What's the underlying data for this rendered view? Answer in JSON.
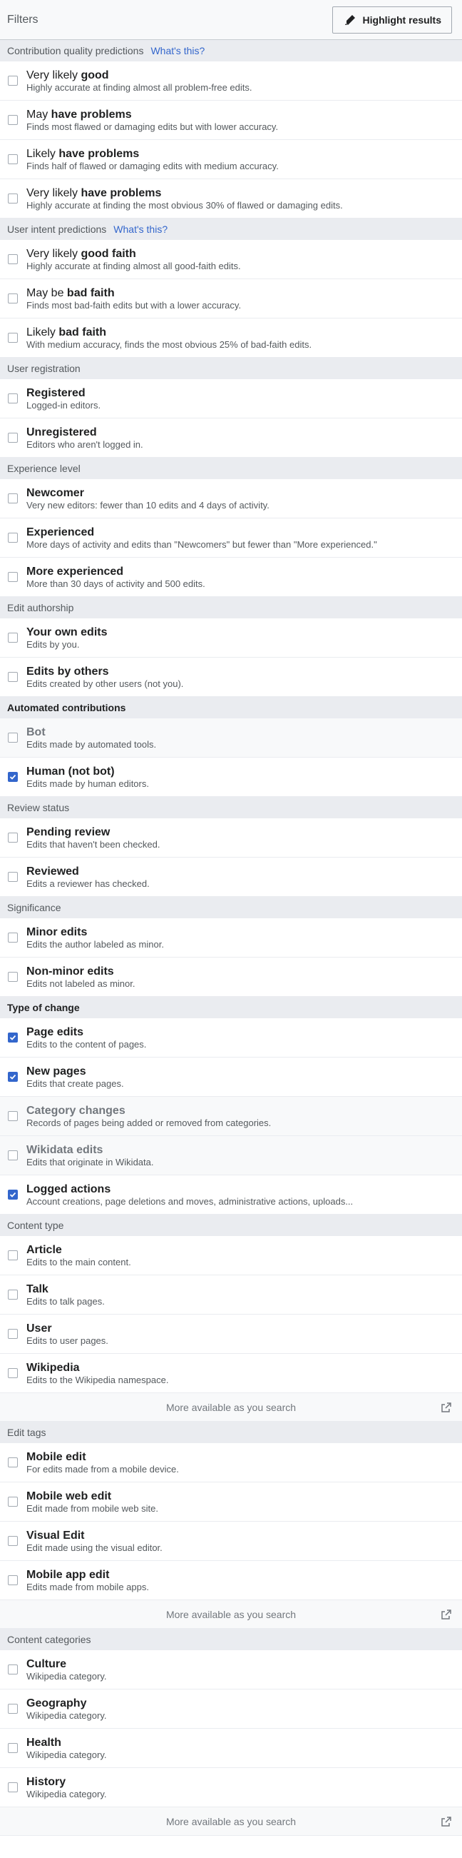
{
  "header": {
    "title": "Filters",
    "highlight_label": "Highlight results"
  },
  "sections": [
    {
      "title": "Contribution quality predictions",
      "link": "What's this?",
      "items": [
        {
          "pre": "Very likely ",
          "strong": "good",
          "post": "",
          "desc": "Highly accurate at finding almost all problem-free edits.",
          "checked": false,
          "muted": false
        },
        {
          "pre": "May ",
          "strong": "have problems",
          "post": "",
          "desc": "Finds most flawed or damaging edits but with lower accuracy.",
          "checked": false,
          "muted": false
        },
        {
          "pre": "Likely ",
          "strong": "have problems",
          "post": "",
          "desc": "Finds half of flawed or damaging edits with medium accuracy.",
          "checked": false,
          "muted": false
        },
        {
          "pre": "Very likely ",
          "strong": "have problems",
          "post": "",
          "desc": "Highly accurate at finding the most obvious 30% of flawed or damaging edits.",
          "checked": false,
          "muted": false
        }
      ]
    },
    {
      "title": "User intent predictions",
      "link": "What's this?",
      "items": [
        {
          "pre": "Very likely ",
          "strong": "good faith",
          "post": "",
          "desc": "Highly accurate at finding almost all good-faith edits.",
          "checked": false,
          "muted": false
        },
        {
          "pre": "May be ",
          "strong": "bad faith",
          "post": "",
          "desc": "Finds most bad-faith edits but with a lower accuracy.",
          "checked": false,
          "muted": false
        },
        {
          "pre": "Likely ",
          "strong": "bad faith",
          "post": "",
          "desc": "With medium accuracy, finds the most obvious 25% of bad-faith edits.",
          "checked": false,
          "muted": false
        }
      ]
    },
    {
      "title": "User registration",
      "items": [
        {
          "pre": "",
          "strong": "Registered",
          "post": "",
          "desc": "Logged-in editors.",
          "checked": false,
          "muted": false
        },
        {
          "pre": "",
          "strong": "Unregistered",
          "post": "",
          "desc": "Editors who aren't logged in.",
          "checked": false,
          "muted": false
        }
      ]
    },
    {
      "title": "Experience level",
      "items": [
        {
          "pre": "",
          "strong": "Newcomer",
          "post": "",
          "desc": "Very new editors: fewer than 10 edits and 4 days of activity.",
          "checked": false,
          "muted": false
        },
        {
          "pre": "",
          "strong": "Experienced",
          "post": "",
          "desc": "More days of activity and edits than \"Newcomers\" but fewer than \"More experienced.\"",
          "checked": false,
          "muted": false
        },
        {
          "pre": "",
          "strong": "More experienced",
          "post": "",
          "desc": "More than 30 days of activity and 500 edits.",
          "checked": false,
          "muted": false
        }
      ]
    },
    {
      "title": "Edit authorship",
      "items": [
        {
          "pre": "",
          "strong": "Your own edits",
          "post": "",
          "desc": "Edits by you.",
          "checked": false,
          "muted": false
        },
        {
          "pre": "",
          "strong": "Edits by others",
          "post": "",
          "desc": "Edits created by other users (not you).",
          "checked": false,
          "muted": false
        }
      ]
    },
    {
      "title": "Automated contributions",
      "bold": true,
      "items": [
        {
          "pre": "",
          "strong": "Bot",
          "post": "",
          "desc": "Edits made by automated tools.",
          "checked": false,
          "muted": true
        },
        {
          "pre": "",
          "strong": "Human (not bot)",
          "post": "",
          "desc": "Edits made by human editors.",
          "checked": true,
          "muted": false
        }
      ]
    },
    {
      "title": "Review status",
      "items": [
        {
          "pre": "",
          "strong": "Pending review",
          "post": "",
          "desc": "Edits that haven't been checked.",
          "checked": false,
          "muted": false
        },
        {
          "pre": "",
          "strong": "Reviewed",
          "post": "",
          "desc": "Edits a reviewer has checked.",
          "checked": false,
          "muted": false
        }
      ]
    },
    {
      "title": "Significance",
      "items": [
        {
          "pre": "",
          "strong": "Minor edits",
          "post": "",
          "desc": "Edits the author labeled as minor.",
          "checked": false,
          "muted": false
        },
        {
          "pre": "",
          "strong": "Non-minor edits",
          "post": "",
          "desc": "Edits not labeled as minor.",
          "checked": false,
          "muted": false
        }
      ]
    },
    {
      "title": "Type of change",
      "bold": true,
      "items": [
        {
          "pre": "",
          "strong": "Page edits",
          "post": "",
          "desc": "Edits to the content of pages.",
          "checked": true,
          "muted": false
        },
        {
          "pre": "",
          "strong": "New pages",
          "post": "",
          "desc": "Edits that create pages.",
          "checked": true,
          "muted": false
        },
        {
          "pre": "",
          "strong": "Category changes",
          "post": "",
          "desc": "Records of pages being added or removed from categories.",
          "checked": false,
          "muted": true
        },
        {
          "pre": "",
          "strong": "Wikidata edits",
          "post": "",
          "desc": "Edits that originate in Wikidata.",
          "checked": false,
          "muted": true
        },
        {
          "pre": "",
          "strong": "Logged actions",
          "post": "",
          "desc": "Account creations, page deletions and moves, administrative actions, uploads...",
          "checked": true,
          "muted": false
        }
      ]
    },
    {
      "title": "Content type",
      "more": "More available as you search",
      "items": [
        {
          "pre": "",
          "strong": "Article",
          "post": "",
          "desc": "Edits to the main content.",
          "checked": false,
          "muted": false
        },
        {
          "pre": "",
          "strong": "Talk",
          "post": "",
          "desc": "Edits to talk pages.",
          "checked": false,
          "muted": false
        },
        {
          "pre": "",
          "strong": "User",
          "post": "",
          "desc": "Edits to user pages.",
          "checked": false,
          "muted": false
        },
        {
          "pre": "",
          "strong": "Wikipedia",
          "post": "",
          "desc": "Edits to the Wikipedia namespace.",
          "checked": false,
          "muted": false
        }
      ]
    },
    {
      "title": "Edit tags",
      "more": "More available as you search",
      "items": [
        {
          "pre": "",
          "strong": "Mobile edit",
          "post": "",
          "desc": "For edits made from a mobile device.",
          "checked": false,
          "muted": false
        },
        {
          "pre": "",
          "strong": "Mobile web edit",
          "post": "",
          "desc": "Edit made from mobile web site.",
          "checked": false,
          "muted": false
        },
        {
          "pre": "",
          "strong": "Visual Edit",
          "post": "",
          "desc": "Edit made using the visual editor.",
          "checked": false,
          "muted": false
        },
        {
          "pre": "",
          "strong": "Mobile app edit",
          "post": "",
          "desc": "Edits made from mobile apps.",
          "checked": false,
          "muted": false
        }
      ]
    },
    {
      "title": "Content categories",
      "more": "More available as you search",
      "items": [
        {
          "pre": "",
          "strong": "Culture",
          "post": "",
          "desc": "Wikipedia category.",
          "checked": false,
          "muted": false
        },
        {
          "pre": "",
          "strong": "Geography",
          "post": "",
          "desc": "Wikipedia category.",
          "checked": false,
          "muted": false
        },
        {
          "pre": "",
          "strong": "Health",
          "post": "",
          "desc": "Wikipedia category.",
          "checked": false,
          "muted": false
        },
        {
          "pre": "",
          "strong": "History",
          "post": "",
          "desc": "Wikipedia category.",
          "checked": false,
          "muted": false
        }
      ]
    }
  ]
}
